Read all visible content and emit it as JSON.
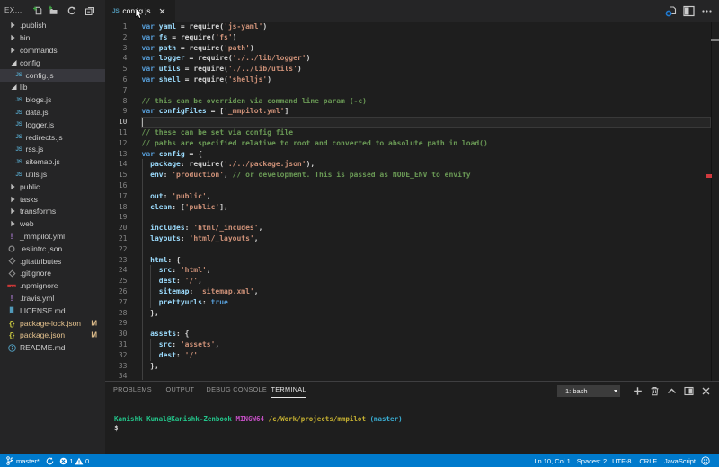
{
  "colors": {
    "statusbar": "#007acc",
    "sidebar_bg": "#252526",
    "editor_bg": "#1e1e1e",
    "selection_bg": "#37373d",
    "modified_file": "#e2c08d",
    "js_icon": "#519aba",
    "json_icon": "#cbcb41",
    "yaml_icon": "#a074c4",
    "npm_icon": "#cb3837",
    "error_marker": "#d13a3e"
  },
  "explorer": {
    "title": "EXPLORER",
    "actions": [
      {
        "name": "new-file"
      },
      {
        "name": "new-folder"
      },
      {
        "name": "refresh"
      },
      {
        "name": "collapse-all"
      }
    ],
    "items": [
      {
        "label": ".publish",
        "kind": "folder",
        "state": "collapsed",
        "indent": 0
      },
      {
        "label": "bin",
        "kind": "folder",
        "state": "collapsed",
        "indent": 0
      },
      {
        "label": "commands",
        "kind": "folder",
        "state": "collapsed",
        "indent": 0
      },
      {
        "label": "config",
        "kind": "folder",
        "state": "expanded",
        "indent": 0
      },
      {
        "label": "config.js",
        "kind": "file",
        "icon": "js",
        "indent": 1,
        "selected": true
      },
      {
        "label": "lib",
        "kind": "folder",
        "state": "expanded",
        "indent": 0
      },
      {
        "label": "blogs.js",
        "kind": "file",
        "icon": "js",
        "indent": 1
      },
      {
        "label": "data.js",
        "kind": "file",
        "icon": "js",
        "indent": 1
      },
      {
        "label": "logger.js",
        "kind": "file",
        "icon": "js",
        "indent": 1
      },
      {
        "label": "redirects.js",
        "kind": "file",
        "icon": "js",
        "indent": 1
      },
      {
        "label": "rss.js",
        "kind": "file",
        "icon": "js",
        "indent": 1
      },
      {
        "label": "sitemap.js",
        "kind": "file",
        "icon": "js",
        "indent": 1
      },
      {
        "label": "utils.js",
        "kind": "file",
        "icon": "js",
        "indent": 1
      },
      {
        "label": "public",
        "kind": "folder",
        "state": "collapsed",
        "indent": 0
      },
      {
        "label": "tasks",
        "kind": "folder",
        "state": "collapsed",
        "indent": 0
      },
      {
        "label": "transforms",
        "kind": "folder",
        "state": "collapsed",
        "indent": 0
      },
      {
        "label": "web",
        "kind": "folder",
        "state": "collapsed",
        "indent": 0
      },
      {
        "label": "_mmpilot.yml",
        "kind": "file",
        "icon": "yaml",
        "indent": 0
      },
      {
        "label": ".eslintrc.json",
        "kind": "file",
        "icon": "eslint",
        "indent": 0
      },
      {
        "label": ".gitattributes",
        "kind": "file",
        "icon": "git",
        "indent": 0
      },
      {
        "label": ".gitignore",
        "kind": "file",
        "icon": "git",
        "indent": 0
      },
      {
        "label": ".npmignore",
        "kind": "file",
        "icon": "npm",
        "indent": 0
      },
      {
        "label": ".travis.yml",
        "kind": "file",
        "icon": "yaml",
        "indent": 0
      },
      {
        "label": "LICENSE.md",
        "kind": "file",
        "icon": "license",
        "indent": 0
      },
      {
        "label": "package-lock.json",
        "kind": "file",
        "icon": "json",
        "indent": 0,
        "badge": "M",
        "modified": true
      },
      {
        "label": "package.json",
        "kind": "file",
        "icon": "json",
        "indent": 0,
        "badge": "M",
        "modified": true
      },
      {
        "label": "README.md",
        "kind": "file",
        "icon": "info",
        "indent": 0
      }
    ]
  },
  "tabbar": {
    "tabs": [
      {
        "label": "config.js",
        "icon": "js",
        "active": true,
        "close_glyph": "×"
      }
    ],
    "actions": [
      {
        "name": "open-changes"
      },
      {
        "name": "split-editor"
      },
      {
        "name": "more-actions"
      }
    ]
  },
  "editor": {
    "cursor": {
      "line": 10,
      "col": 1
    },
    "lines": [
      {
        "n": 1,
        "segs": [
          [
            "k",
            "var "
          ],
          [
            "v",
            "yaml"
          ],
          [
            "p",
            " = "
          ],
          [
            "f",
            "require"
          ],
          [
            "p",
            "("
          ],
          [
            "s",
            "'js-yaml'"
          ],
          [
            "p",
            ")"
          ]
        ]
      },
      {
        "n": 2,
        "segs": [
          [
            "k",
            "var "
          ],
          [
            "v",
            "fs"
          ],
          [
            "p",
            " = "
          ],
          [
            "f",
            "require"
          ],
          [
            "p",
            "("
          ],
          [
            "s",
            "'fs'"
          ],
          [
            "p",
            ")"
          ]
        ]
      },
      {
        "n": 3,
        "segs": [
          [
            "k",
            "var "
          ],
          [
            "v",
            "path"
          ],
          [
            "p",
            " = "
          ],
          [
            "f",
            "require"
          ],
          [
            "p",
            "("
          ],
          [
            "s",
            "'path'"
          ],
          [
            "p",
            ")"
          ]
        ]
      },
      {
        "n": 4,
        "segs": [
          [
            "k",
            "var "
          ],
          [
            "v",
            "logger"
          ],
          [
            "p",
            " = "
          ],
          [
            "f",
            "require"
          ],
          [
            "p",
            "("
          ],
          [
            "s",
            "'./../lib/logger'"
          ],
          [
            "p",
            ")"
          ]
        ]
      },
      {
        "n": 5,
        "segs": [
          [
            "k",
            "var "
          ],
          [
            "v",
            "utils"
          ],
          [
            "p",
            " = "
          ],
          [
            "f",
            "require"
          ],
          [
            "p",
            "("
          ],
          [
            "s",
            "'./../lib/utils'"
          ],
          [
            "p",
            ")"
          ]
        ]
      },
      {
        "n": 6,
        "segs": [
          [
            "k",
            "var "
          ],
          [
            "v",
            "shell"
          ],
          [
            "p",
            " = "
          ],
          [
            "f",
            "require"
          ],
          [
            "p",
            "("
          ],
          [
            "s",
            "'shelljs'"
          ],
          [
            "p",
            ")"
          ]
        ]
      },
      {
        "n": 7,
        "segs": []
      },
      {
        "n": 8,
        "segs": [
          [
            "c",
            "// this can be overriden via command line param (-c)"
          ]
        ]
      },
      {
        "n": 9,
        "segs": [
          [
            "k",
            "var "
          ],
          [
            "v",
            "configFiles"
          ],
          [
            "p",
            " = ["
          ],
          [
            "s",
            "'_mmpilot.yml'"
          ],
          [
            "p",
            "]"
          ]
        ]
      },
      {
        "n": 10,
        "segs": []
      },
      {
        "n": 11,
        "segs": [
          [
            "c",
            "// these can be set via config file"
          ]
        ]
      },
      {
        "n": 12,
        "segs": [
          [
            "c",
            "// paths are specified relative to root and converted to absolute path in load()"
          ]
        ]
      },
      {
        "n": 13,
        "segs": [
          [
            "k",
            "var "
          ],
          [
            "v",
            "config"
          ],
          [
            "p",
            " = {"
          ]
        ]
      },
      {
        "n": 14,
        "segs": [
          [
            "p",
            "  "
          ],
          [
            "v",
            "package"
          ],
          [
            "p",
            ": "
          ],
          [
            "f",
            "require"
          ],
          [
            "p",
            "("
          ],
          [
            "s",
            "'./../package.json'"
          ],
          [
            "p",
            "),"
          ]
        ]
      },
      {
        "n": 15,
        "segs": [
          [
            "p",
            "  "
          ],
          [
            "v",
            "env"
          ],
          [
            "p",
            ": "
          ],
          [
            "s",
            "'production'"
          ],
          [
            "p",
            ", "
          ],
          [
            "c",
            "// or development. This is passed as NODE_ENV to envify"
          ]
        ]
      },
      {
        "n": 16,
        "segs": []
      },
      {
        "n": 17,
        "segs": [
          [
            "p",
            "  "
          ],
          [
            "v",
            "out"
          ],
          [
            "p",
            ": "
          ],
          [
            "s",
            "'public'"
          ],
          [
            "p",
            ","
          ]
        ]
      },
      {
        "n": 18,
        "segs": [
          [
            "p",
            "  "
          ],
          [
            "v",
            "clean"
          ],
          [
            "p",
            ": ["
          ],
          [
            "s",
            "'public'"
          ],
          [
            "p",
            "],"
          ]
        ]
      },
      {
        "n": 19,
        "segs": []
      },
      {
        "n": 20,
        "segs": [
          [
            "p",
            "  "
          ],
          [
            "v",
            "includes"
          ],
          [
            "p",
            ": "
          ],
          [
            "s",
            "'html/_incudes'"
          ],
          [
            "p",
            ","
          ]
        ]
      },
      {
        "n": 21,
        "segs": [
          [
            "p",
            "  "
          ],
          [
            "v",
            "layouts"
          ],
          [
            "p",
            ": "
          ],
          [
            "s",
            "'html/_layouts'"
          ],
          [
            "p",
            ","
          ]
        ]
      },
      {
        "n": 22,
        "segs": []
      },
      {
        "n": 23,
        "segs": [
          [
            "p",
            "  "
          ],
          [
            "v",
            "html"
          ],
          [
            "p",
            ": {"
          ]
        ]
      },
      {
        "n": 24,
        "segs": [
          [
            "p",
            "    "
          ],
          [
            "v",
            "src"
          ],
          [
            "p",
            ": "
          ],
          [
            "s",
            "'html'"
          ],
          [
            "p",
            ","
          ]
        ]
      },
      {
        "n": 25,
        "segs": [
          [
            "p",
            "    "
          ],
          [
            "v",
            "dest"
          ],
          [
            "p",
            ": "
          ],
          [
            "s",
            "'/'"
          ],
          [
            "p",
            ","
          ]
        ]
      },
      {
        "n": 26,
        "segs": [
          [
            "p",
            "    "
          ],
          [
            "v",
            "sitemap"
          ],
          [
            "p",
            ": "
          ],
          [
            "s",
            "'sitemap.xml'"
          ],
          [
            "p",
            ","
          ]
        ]
      },
      {
        "n": 27,
        "segs": [
          [
            "p",
            "    "
          ],
          [
            "v",
            "prettyurls"
          ],
          [
            "p",
            ": "
          ],
          [
            "k",
            "true"
          ]
        ]
      },
      {
        "n": 28,
        "segs": [
          [
            "p",
            "  },"
          ]
        ]
      },
      {
        "n": 29,
        "segs": []
      },
      {
        "n": 30,
        "segs": [
          [
            "p",
            "  "
          ],
          [
            "v",
            "assets"
          ],
          [
            "p",
            ": {"
          ]
        ]
      },
      {
        "n": 31,
        "segs": [
          [
            "p",
            "    "
          ],
          [
            "v",
            "src"
          ],
          [
            "p",
            ": "
          ],
          [
            "s",
            "'assets'"
          ],
          [
            "p",
            ","
          ]
        ]
      },
      {
        "n": 32,
        "segs": [
          [
            "p",
            "    "
          ],
          [
            "v",
            "dest"
          ],
          [
            "p",
            ": "
          ],
          [
            "s",
            "'/'"
          ]
        ]
      },
      {
        "n": 33,
        "segs": [
          [
            "p",
            "  },"
          ]
        ]
      },
      {
        "n": 34,
        "segs": []
      }
    ]
  },
  "panel": {
    "tabs": [
      {
        "label": "PROBLEMS"
      },
      {
        "label": "OUTPUT"
      },
      {
        "label": "DEBUG CONSOLE"
      },
      {
        "label": "TERMINAL",
        "active": true
      }
    ],
    "terminal_select": "1: bash",
    "actions": [
      {
        "name": "new-terminal"
      },
      {
        "name": "kill-terminal"
      },
      {
        "name": "maximize-panel"
      },
      {
        "name": "move-panel"
      },
      {
        "name": "close-panel"
      }
    ],
    "terminal_lines": [
      {
        "segs": [
          [
            "g",
            "Kanishk Kunal@Kanishk-Zenbook"
          ],
          [
            "w",
            " "
          ],
          [
            "m",
            "MINGW64"
          ],
          [
            "w",
            " "
          ],
          [
            "y",
            "/c/Work/projects/mmpilot"
          ],
          [
            "w",
            " "
          ],
          [
            "c",
            "(master)"
          ]
        ]
      },
      {
        "segs": [
          [
            "w",
            "$"
          ]
        ]
      }
    ]
  },
  "statusbar": {
    "branch": "master*",
    "errors": "1",
    "warnings": "0",
    "right_items": [
      {
        "name": "cursor-position",
        "label": "Ln 10, Col 1"
      },
      {
        "name": "indentation",
        "label": "Spaces: 2"
      },
      {
        "name": "encoding",
        "label": "UTF-8"
      },
      {
        "name": "eol",
        "label": "CRLF"
      },
      {
        "name": "language",
        "label": "JavaScript"
      }
    ]
  }
}
